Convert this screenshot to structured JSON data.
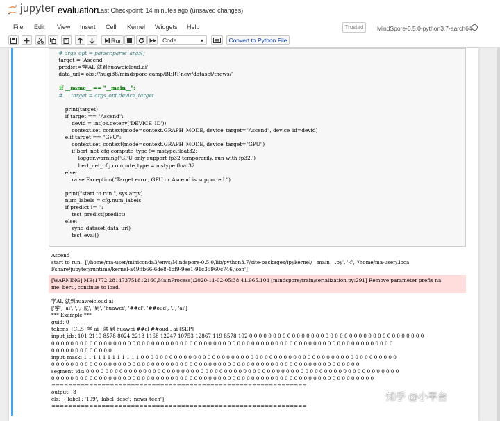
{
  "header": {
    "logo_text": "jupyter",
    "notebook_name": "evaluation",
    "checkpoint": "Last Checkpoint: 14 minutes ago  (unsaved changes)"
  },
  "menu": {
    "items": [
      "File",
      "Edit",
      "View",
      "Insert",
      "Cell",
      "Kernel",
      "Widgets",
      "Help"
    ],
    "trusted": "Trusted",
    "kernel_name": "MindSpore-0.5.0-python3.7-aarch64"
  },
  "toolbar": {
    "run_label": "Run",
    "cell_type": "Code",
    "convert_label": "Convert to Python File"
  },
  "code_lines": [
    "    # args_opt = parser.parse_args()",
    "    target = 'Ascend'",
    "    predict='学AI, 就到huaweicloud.ai'",
    "    data_url='obs://huqi88/mindspore-camp/BERT-new/dataset/tnews/'",
    "",
    "    if __name__ == \"__main__\":",
    "    #     target = args_opt.device_target",
    "",
    "        print(target)",
    "        if target == \"Ascend\":",
    "            devid = int(os.getenv('DEVICE_ID'))",
    "            context.set_context(mode=context.GRAPH_MODE, device_target=\"Ascend\", device_id=devid)",
    "        elif target == \"GPU\":",
    "            context.set_context(mode=context.GRAPH_MODE, device_target=\"GPU\")",
    "            if bert_net_cfg.compute_type != mstype.float32:",
    "                logger.warning('GPU only support fp32 temporarily, run with fp32.')",
    "                bert_net_cfg.compute_type = mstype.float32",
    "        else:",
    "            raise Exception(\"Target error, GPU or Ascend is supported.\")",
    "",
    "        print(\"start to run.\", sys.argv)",
    "        num_labels = cfg.num_labels",
    "        if predict != '':",
    "            test_predict(predict)",
    "        else:",
    "            sync_dataset(data_url)",
    "            test_eval()"
  ],
  "output": {
    "stdout_1": [
      "Ascend",
      "start to run.  ['/home/ma-user/miniconda3/envs/Mindspore-0.5.0/lib/python3.7/site-packages/ipykernel/__main__.py', '-f', '/home/ma-user/.loca",
      "l/share/jupyter/runtime/kernel-a49ffb66-6de8-4df9-9ee1-91c35960c746.json']"
    ],
    "warning": [
      "[WARNING] ME(1772:281473751812160,MainProcess):2020-11-02-05:38:41.965.104 [mindspore/train/serialization.py:291] Remove parameter prefix na",
      "me: bert., continue to load."
    ],
    "stdout_2": [
      "学AI, 就到huaweicloud.ai",
      "['学', 'ai', ',', '就', '到', 'huawei', '##cl', '##oud', '.', 'ai']",
      "*** Example ***",
      "guid: 0",
      "tokens: [CLS] 学 ai , 就 到 huawei ##cl ##oud . ai [SEP]",
      "input_ids: 101 2110 8578 8024 2218 1168 12247 10753 12867 119 8578 102 0 0 0 0 0 0 0 0 0 0 0 0 0 0 0 0 0 0 0 0 0 0 0 0 0 0 0 0 0 0 0 0 0 0 0 0 0",
      "0 0 0 0 0 0 0 0 0 0 0 0 0 0 0 0 0 0 0 0 0 0 0 0 0 0 0 0 0 0 0 0 0 0 0 0 0 0 0 0 0 0 0 0 0 0 0 0 0 0 0 0 0 0 0 0 0 0 0 0 0 0 0 0 0 0 0 0 0 0 0 0",
      "0 0 0 0 0 0 0 0 0 0 0 0 0",
      "input_mask: 1 1 1 1 1 1 1 1 1 1 1 1 0 0 0 0 0 0 0 0 0 0 0 0 0 0 0 0 0 0 0 0 0 0 0 0 0 0 0 0 0 0 0 0 0 0 0 0 0 0 0 0 0 0 0 0 0 0 0 0 0 0 0 0 0 0",
      "0 0 0 0 0 0 0 0 0 0 0 0 0 0 0 0 0 0 0 0 0 0 0 0 0 0 0 0 0 0 0 0 0 0 0 0 0 0 0 0 0 0 0 0 0 0 0 0 0 0 0 0 0 0 0 0 0 0 0 0 0 0 0 0 0",
      "segment_ids: 0 0 0 0 0 0 0 0 0 0 0 0 0 0 0 0 0 0 0 0 0 0 0 0 0 0 0 0 0 0 0 0 0 0 0 0 0 0 0 0 0 0 0 0 0 0 0 0 0 0 0 0 0 0 0 0 0 0 0 0 0 0 0 0 0 0",
      "0 0 0 0 0 0 0 0 0 0 0 0 0 0 0 0 0 0 0 0 0 0 0 0 0 0 0 0 0 0 0 0 0 0 0 0 0 0 0 0 0 0 0 0 0 0 0 0 0 0 0 0 0 0 0 0 0 0 0 0 0 0 0 0 0 0 0 0"
    ],
    "separator": "=============================================================",
    "result": [
      "output:  8",
      "cls:  {'label': '109', 'label_desc': 'news_tech'}"
    ]
  },
  "watermark": "知乎 @小平台"
}
